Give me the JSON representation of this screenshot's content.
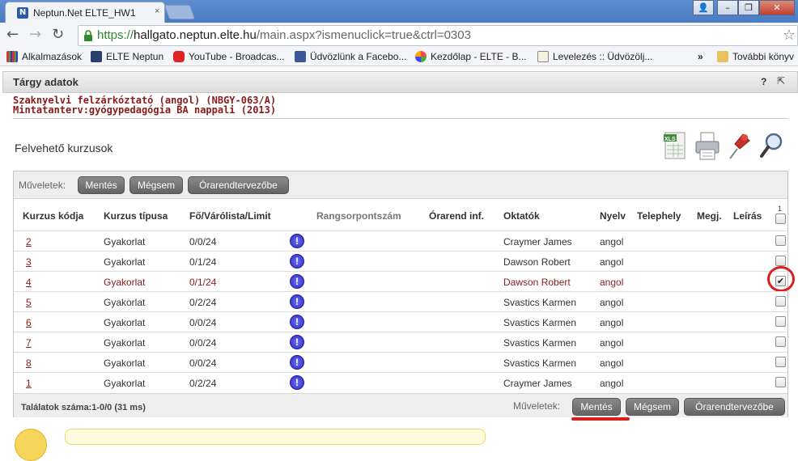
{
  "browser": {
    "tab_title": "Neptun.Net ELTE_HW1",
    "tab_close": "×",
    "url_proto": "https://",
    "url_host": "hallgato.neptun.elte.hu",
    "url_path": "/main.aspx?ismenuclick=true&ctrl=0303",
    "bookmarks": [
      {
        "label": "Alkalmazások",
        "icon": "apps-grid-icon"
      },
      {
        "label": "ELTE Neptun",
        "icon": "elte-icon"
      },
      {
        "label": "YouTube - Broadcas...",
        "icon": "youtube-icon"
      },
      {
        "label": "Üdvözlünk a Facebo...",
        "icon": "facebook-icon"
      },
      {
        "label": "Kezdőlap - ELTE - B...",
        "icon": "joomla-icon"
      },
      {
        "label": "Levelezés :: Üdvözölj...",
        "icon": "mail-icon"
      }
    ],
    "bookmarks_more": "»",
    "other_bookmarks": "További könyv"
  },
  "panel": {
    "title": "Tárgy adatok",
    "help": "?",
    "popout": "⇱"
  },
  "subject": {
    "line1": "Szaknyelvi felzárkóztató (angol) (NBGY-063/A)",
    "line2": "Mintatanterv:gyógypedagógia BA nappali (2013)"
  },
  "section_title": "Felvehető kurzusok",
  "toolbar_icons": [
    "xls-export-icon",
    "print-icon",
    "pin-icon",
    "search-magnifier-icon"
  ],
  "ops": {
    "label": "Műveletek:",
    "save": "Mentés",
    "cancel": "Mégsem",
    "timetable": "Órarendtervezőbe"
  },
  "columns": {
    "code": "Kurzus kódja",
    "type": "Kurzus típusa",
    "count": "Fő/Várólista/Limit",
    "rank": "Rangsorpontszám",
    "schedule": "Órarend inf.",
    "teachers": "Oktatók",
    "lang": "Nyelv",
    "site": "Telephely",
    "note": "Megj.",
    "desc": "Leírás",
    "select_count": "1"
  },
  "rows": [
    {
      "code": "2",
      "type": "Gyakorlat",
      "count": "0/0/24",
      "teacher": "Craymer James",
      "lang": "angol",
      "checked": false
    },
    {
      "code": "3",
      "type": "Gyakorlat",
      "count": "0/1/24",
      "teacher": "Dawson Robert",
      "lang": "angol",
      "checked": false
    },
    {
      "code": "4",
      "type": "Gyakorlat",
      "count": "0/1/24",
      "teacher": "Dawson Robert",
      "lang": "angol",
      "checked": true
    },
    {
      "code": "5",
      "type": "Gyakorlat",
      "count": "0/2/24",
      "teacher": "Svastics Karmen",
      "lang": "angol",
      "checked": false
    },
    {
      "code": "6",
      "type": "Gyakorlat",
      "count": "0/0/24",
      "teacher": "Svastics Karmen",
      "lang": "angol",
      "checked": false
    },
    {
      "code": "7",
      "type": "Gyakorlat",
      "count": "0/0/24",
      "teacher": "Svastics Karmen",
      "lang": "angol",
      "checked": false
    },
    {
      "code": "8",
      "type": "Gyakorlat",
      "count": "0/0/24",
      "teacher": "Svastics Karmen",
      "lang": "angol",
      "checked": false
    },
    {
      "code": "1",
      "type": "Gyakorlat",
      "count": "0/2/24",
      "teacher": "Craymer James",
      "lang": "angol",
      "checked": false
    }
  ],
  "info_glyph": "!",
  "check_glyph": "✔",
  "footer": {
    "count": "Találatok száma:1-0/0 (31 ms)",
    "ops_label": "Műveletek:"
  },
  "colors": {
    "accent_red": "#8b1a1a",
    "highlight_red": "#d81e1e"
  }
}
